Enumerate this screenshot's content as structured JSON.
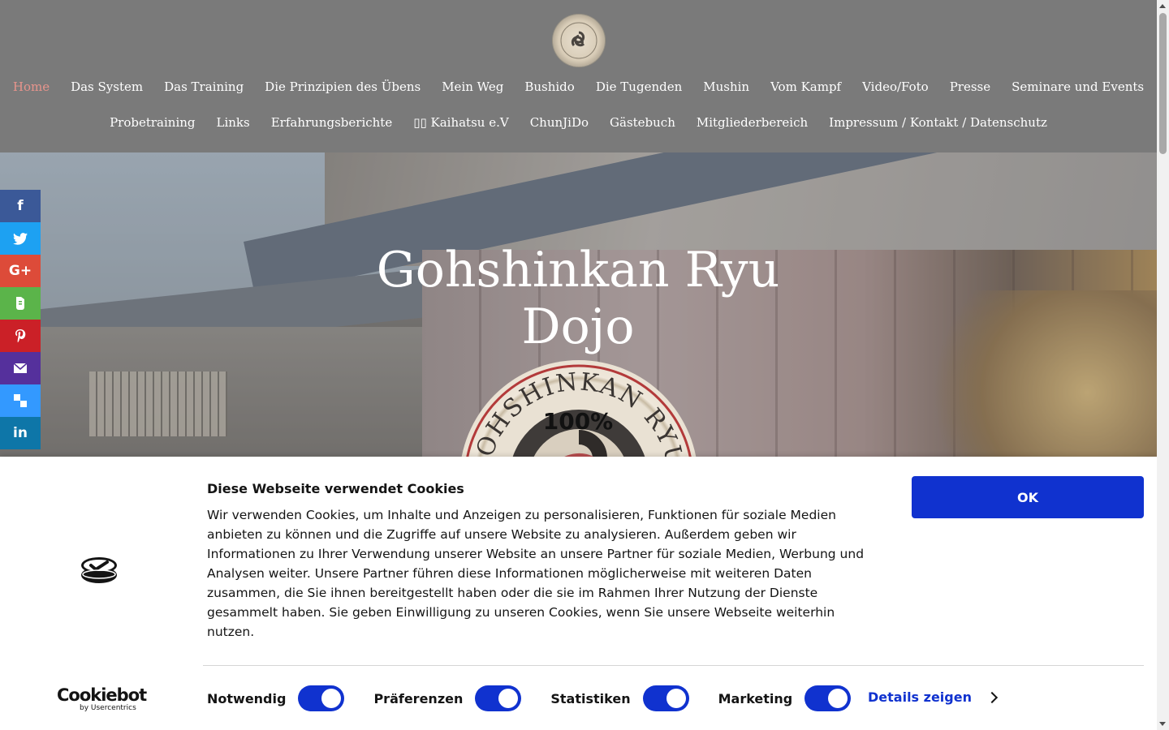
{
  "nav": {
    "row1": [
      {
        "label": "Home",
        "active": true
      },
      {
        "label": "Das System"
      },
      {
        "label": "Das Training"
      },
      {
        "label": "Die Prinzipien des Übens"
      },
      {
        "label": "Mein Weg"
      },
      {
        "label": "Bushido"
      },
      {
        "label": "Die Tugenden"
      },
      {
        "label": "Mushin"
      },
      {
        "label": "Vom Kampf"
      },
      {
        "label": "Video/Foto"
      },
      {
        "label": "Presse"
      },
      {
        "label": "Seminare und Events"
      }
    ],
    "row2": [
      {
        "label": "Probetraining"
      },
      {
        "label": "Links"
      },
      {
        "label": "Erfahrungsberichte"
      },
      {
        "label": "▯▯ Kaihatsu e.V"
      },
      {
        "label": "ChunJiDo"
      },
      {
        "label": "Gästebuch"
      },
      {
        "label": "Mitgliederbereich"
      },
      {
        "label": "Impressum / Kontakt / Datenschutz"
      }
    ],
    "active_color": "#e8948c"
  },
  "hero": {
    "title_line1": "Gohshinkan Ryu",
    "title_line2": "Dojo",
    "loading_percent": "100%",
    "badge_text": "GOHSHINKAN RYU"
  },
  "share": [
    {
      "icon": "facebook-icon",
      "glyph": "f"
    },
    {
      "icon": "twitter-icon",
      "glyph": "🐦"
    },
    {
      "icon": "google-plus-icon",
      "glyph": "G+"
    },
    {
      "icon": "evernote-icon",
      "glyph": "🐘"
    },
    {
      "icon": "pinterest-icon",
      "glyph": "P"
    },
    {
      "icon": "email-icon",
      "glyph": "✉"
    },
    {
      "icon": "delicious-icon",
      "glyph": "▚"
    },
    {
      "icon": "linkedin-icon",
      "glyph": "in"
    }
  ],
  "cookie": {
    "title": "Diese Webseite verwendet Cookies",
    "text": "Wir verwenden Cookies, um Inhalte und Anzeigen zu personalisieren, Funktionen für soziale Medien anbieten zu können und die Zugriffe auf unsere Website zu analysieren. Außerdem geben wir Informationen zu Ihrer Verwendung unserer Website an unsere Partner für soziale Medien, Werbung und Analysen weiter. Unsere Partner führen diese Informationen möglicherweise mit weiteren Daten zusammen, die Sie ihnen bereitgestellt haben oder die sie im Rahmen Ihrer Nutzung der Dienste gesammelt haben. Sie geben Einwilligung zu unseren Cookies, wenn Sie unsere Webseite weiterhin nutzen.",
    "ok_label": "OK",
    "brand_name": "Cookiebot",
    "brand_by": "by Usercentrics",
    "toggles": [
      {
        "label": "Notwendig",
        "on": true
      },
      {
        "label": "Präferenzen",
        "on": true
      },
      {
        "label": "Statistiken",
        "on": true
      },
      {
        "label": "Marketing",
        "on": true
      }
    ],
    "details_label": "Details zeigen",
    "accent_color": "#1032cf"
  }
}
